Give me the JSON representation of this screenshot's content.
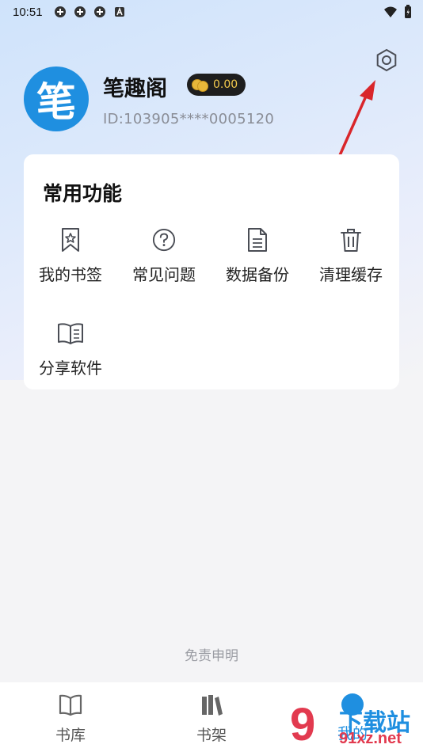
{
  "status_bar": {
    "time": "10:51"
  },
  "profile": {
    "avatar_char": "笔",
    "name": "笔趣阁",
    "coins": "0.00",
    "id": "ID:103905****0005120"
  },
  "functions": {
    "title": "常用功能",
    "items": [
      {
        "label": "我的书签",
        "icon": "bookmark-icon"
      },
      {
        "label": "常见问题",
        "icon": "question-icon"
      },
      {
        "label": "数据备份",
        "icon": "document-icon"
      },
      {
        "label": "清理缓存",
        "icon": "trash-icon"
      },
      {
        "label": "分享软件",
        "icon": "open-book-icon"
      }
    ]
  },
  "disclaimer": "免责申明",
  "nav": {
    "items": [
      {
        "label": "书库",
        "icon": "book-icon"
      },
      {
        "label": "书架",
        "icon": "bookshelf-icon"
      },
      {
        "label": "我的",
        "icon": "profile-icon",
        "active": true
      }
    ]
  },
  "watermark": {
    "nine": "9",
    "top": "下载站",
    "bottom": "91xz.net"
  },
  "colors": {
    "accent": "#1f8fe0",
    "annotation": "#d9262b",
    "coin": "#f2c94c"
  }
}
